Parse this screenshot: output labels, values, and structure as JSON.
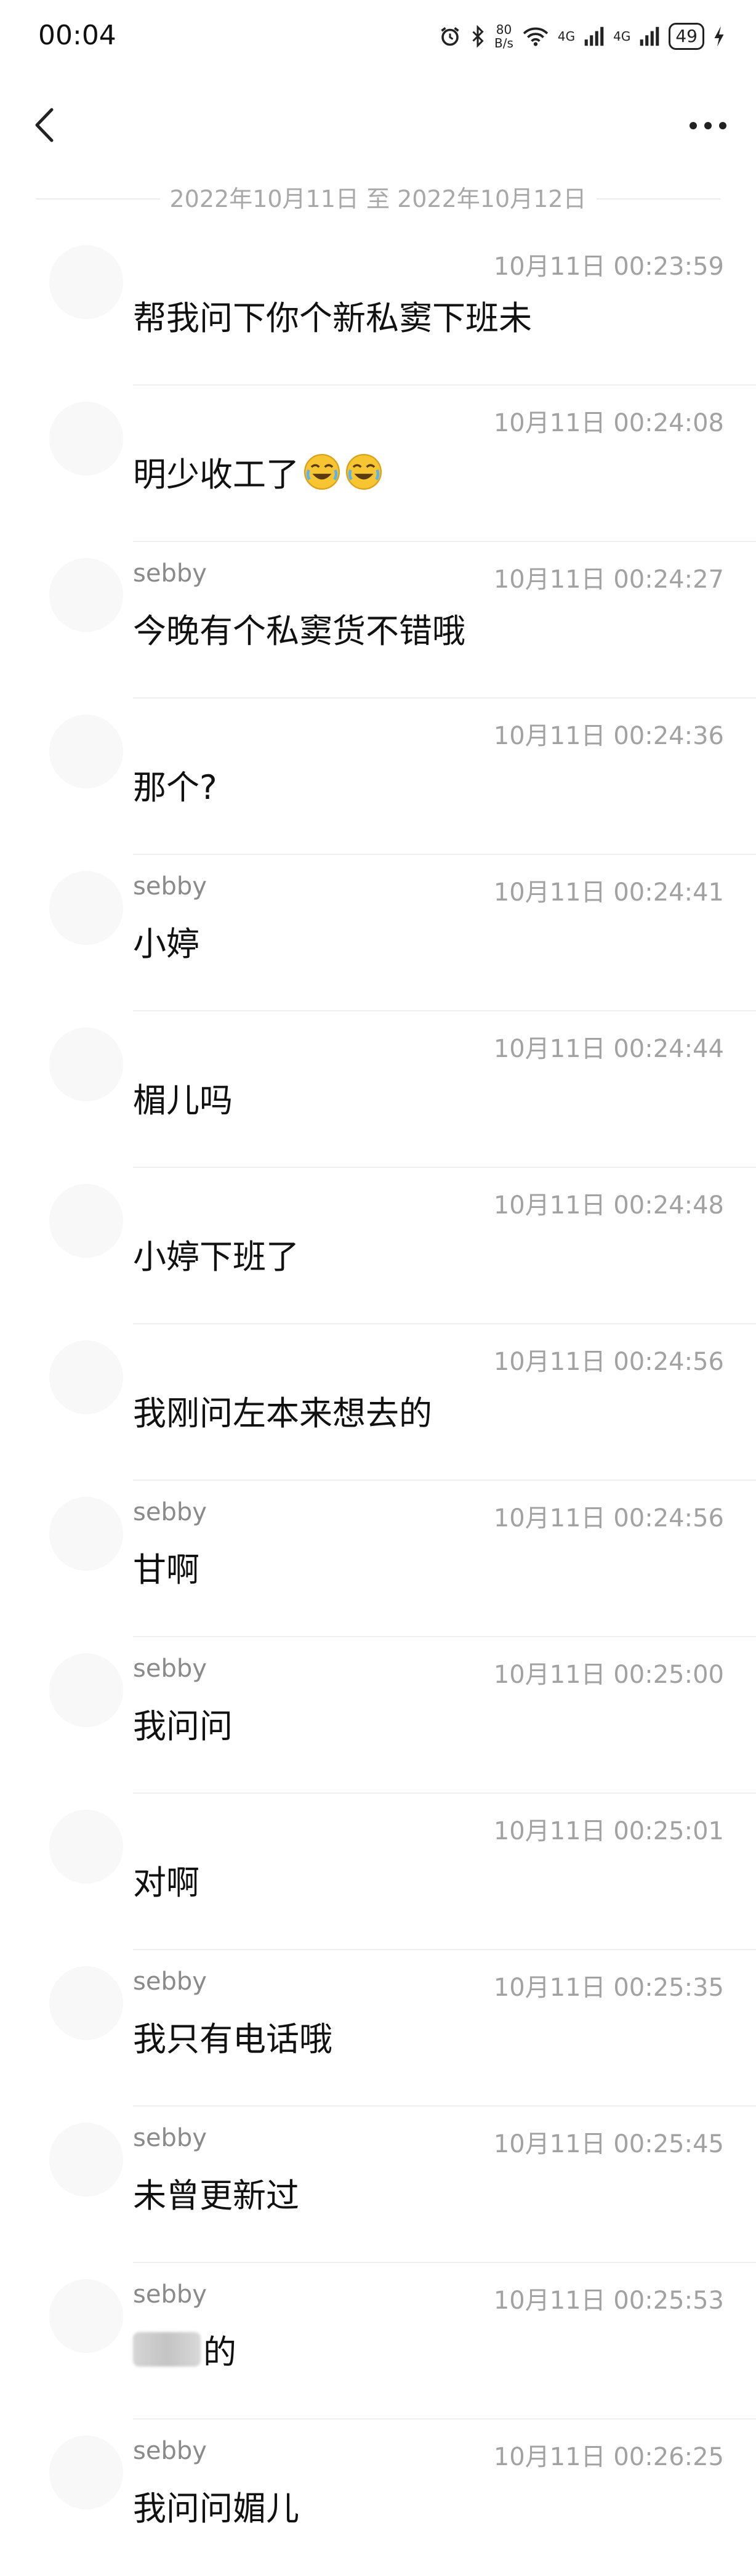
{
  "status": {
    "time": "00:04",
    "netspeed_top": "80",
    "netspeed_bottom": "B/s",
    "signal1": "4G",
    "signal2": "4G",
    "battery": "49"
  },
  "header": {
    "range": "2022年10月11日 至 2022年10月12日"
  },
  "messages": [
    {
      "sender": "",
      "time": "10月11日 00:23:59",
      "text": "帮我问下你个新私窦下班未"
    },
    {
      "sender": "",
      "time": "10月11日 00:24:08",
      "text": "明少收工了",
      "emoji": "laugh-cry-emoji"
    },
    {
      "sender": "sebby",
      "time": "10月11日 00:24:27",
      "text": "今晚有个私窦货不错哦"
    },
    {
      "sender": "",
      "time": "10月11日 00:24:36",
      "text": "那个?"
    },
    {
      "sender": "sebby",
      "time": "10月11日 00:24:41",
      "text": "小婷"
    },
    {
      "sender": "",
      "time": "10月11日 00:24:44",
      "text": "楣儿吗"
    },
    {
      "sender": "",
      "time": "10月11日 00:24:48",
      "text": "小婷下班了"
    },
    {
      "sender": "",
      "time": "10月11日 00:24:56",
      "text": "我刚问左本来想去的"
    },
    {
      "sender": "sebby",
      "time": "10月11日 00:24:56",
      "text": "甘啊"
    },
    {
      "sender": "sebby",
      "time": "10月11日 00:25:00",
      "text": "我问问"
    },
    {
      "sender": "",
      "time": "10月11日 00:25:01",
      "text": "对啊"
    },
    {
      "sender": "sebby",
      "time": "10月11日 00:25:35",
      "text": "我只有电话哦"
    },
    {
      "sender": "sebby",
      "time": "10月11日 00:25:45",
      "text": "未曾更新过"
    },
    {
      "sender": "sebby",
      "time": "10月11日 00:25:53",
      "text": "的",
      "blurred_prefix": true
    },
    {
      "sender": "sebby",
      "time": "10月11日 00:26:25",
      "text": "我问问媚儿"
    }
  ]
}
